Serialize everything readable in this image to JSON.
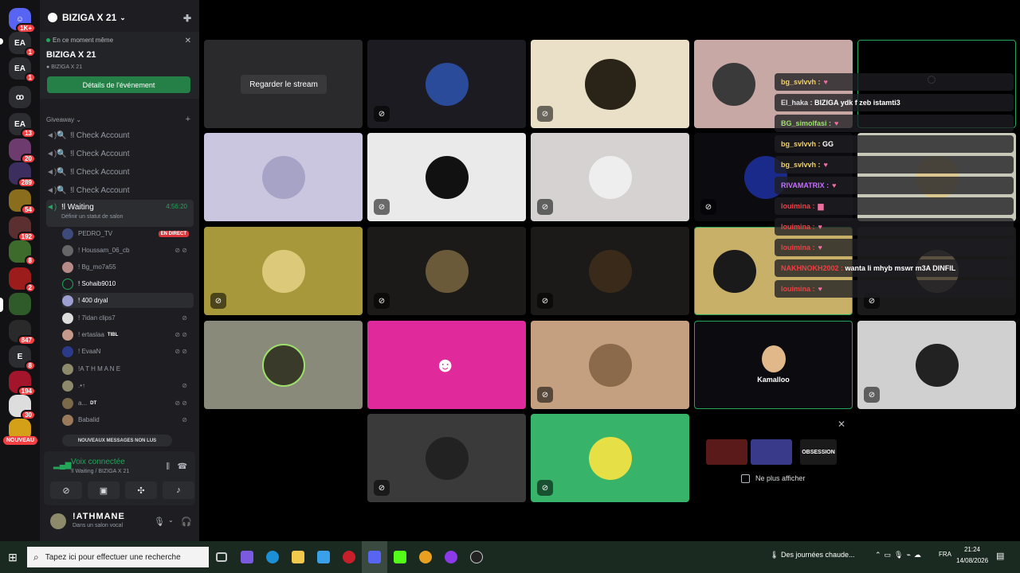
{
  "server": {
    "name": "BIZIGA X 21"
  },
  "event": {
    "status": "En ce moment même",
    "title": "BIZIGA X 21",
    "location": "BIZIGA X 21",
    "button": "Détails de l'événement"
  },
  "rail": {
    "badges": [
      "1K+",
      "1",
      "1",
      "13",
      "20",
      "289",
      "54",
      "192",
      "8",
      "2",
      "847",
      "8",
      "194",
      "30"
    ],
    "nouveau": "NOUVEAU"
  },
  "category": {
    "name": "Giveaway"
  },
  "channels": [
    "!l Check Account",
    "!l Check Account",
    "!l Check Account",
    "!l Check Account"
  ],
  "active_channel": {
    "name": "!l Waiting",
    "timer": "4:56:20",
    "status": "Définir un statut de salon"
  },
  "members": [
    {
      "name": "PEDRO_TV",
      "live": "EN DIRECT"
    },
    {
      "name": "! Houssam_06_cb"
    },
    {
      "name": "! Bg_mo7a55"
    },
    {
      "name": "! Sohaib9010"
    },
    {
      "name": "! 400 dryal"
    },
    {
      "name": "! 7idan clips7"
    },
    {
      "name": "! ertaslaa",
      "tag": "TIBL"
    },
    {
      "name": "! EvaaN"
    },
    {
      "name": "!A T H M A N E"
    },
    {
      "name": ".•↑"
    },
    {
      "name": "a...",
      "tag": "DT"
    },
    {
      "name": "Babalid"
    }
  ],
  "new_messages": "NOUVEAUX MESSAGES NON LUS",
  "voice": {
    "status": "Voix connectée",
    "channel": "!l Waiting / BIZIGA X 21"
  },
  "user": {
    "name": "!ATHMANE",
    "status": "Dans un salon vocal"
  },
  "stage": {
    "watch_stream": "Regarder le stream",
    "kamalloo": "Kamalloo",
    "promo_checkbox": "Ne plus afficher",
    "promo_obsession": "OBSESSION"
  },
  "chat": [
    {
      "user": "bg_svlvvh :",
      "text": "",
      "heart": true
    },
    {
      "user": "El_haka :",
      "text": "BIZIGA ydk f zeb istamti3",
      "heart": false
    },
    {
      "user": "BG_simolfasi :",
      "text": "",
      "heart": true
    },
    {
      "user": "bg_svlvvh :",
      "text": "GG",
      "heart": false
    },
    {
      "user": "bg_svlvvh :",
      "text": "",
      "heart": true
    },
    {
      "user": "RIVAMATRIX :",
      "text": "",
      "heart": true
    },
    {
      "user": "louimina :",
      "text": "",
      "heart": false
    },
    {
      "user": "louimina :",
      "text": "",
      "heart": true
    },
    {
      "user": "louimina :",
      "text": "",
      "heart": true
    },
    {
      "user": "NAKHNOKH2002 :",
      "text": "wanta li mhyb mswr m3A DINFIL",
      "heart": false
    },
    {
      "user": "louimina :",
      "text": "",
      "heart": true
    }
  ],
  "taskbar": {
    "search_placeholder": "Tapez ici pour effectuer une recherche",
    "news": "Des journées chaude...",
    "lang": "FRA",
    "time": "21:24",
    "date": "14/08/2026"
  },
  "colors": {
    "accent_green": "#23a55a",
    "button_green": "#248046",
    "danger": "#f23f43",
    "discord_pink": "#e02a9c"
  }
}
